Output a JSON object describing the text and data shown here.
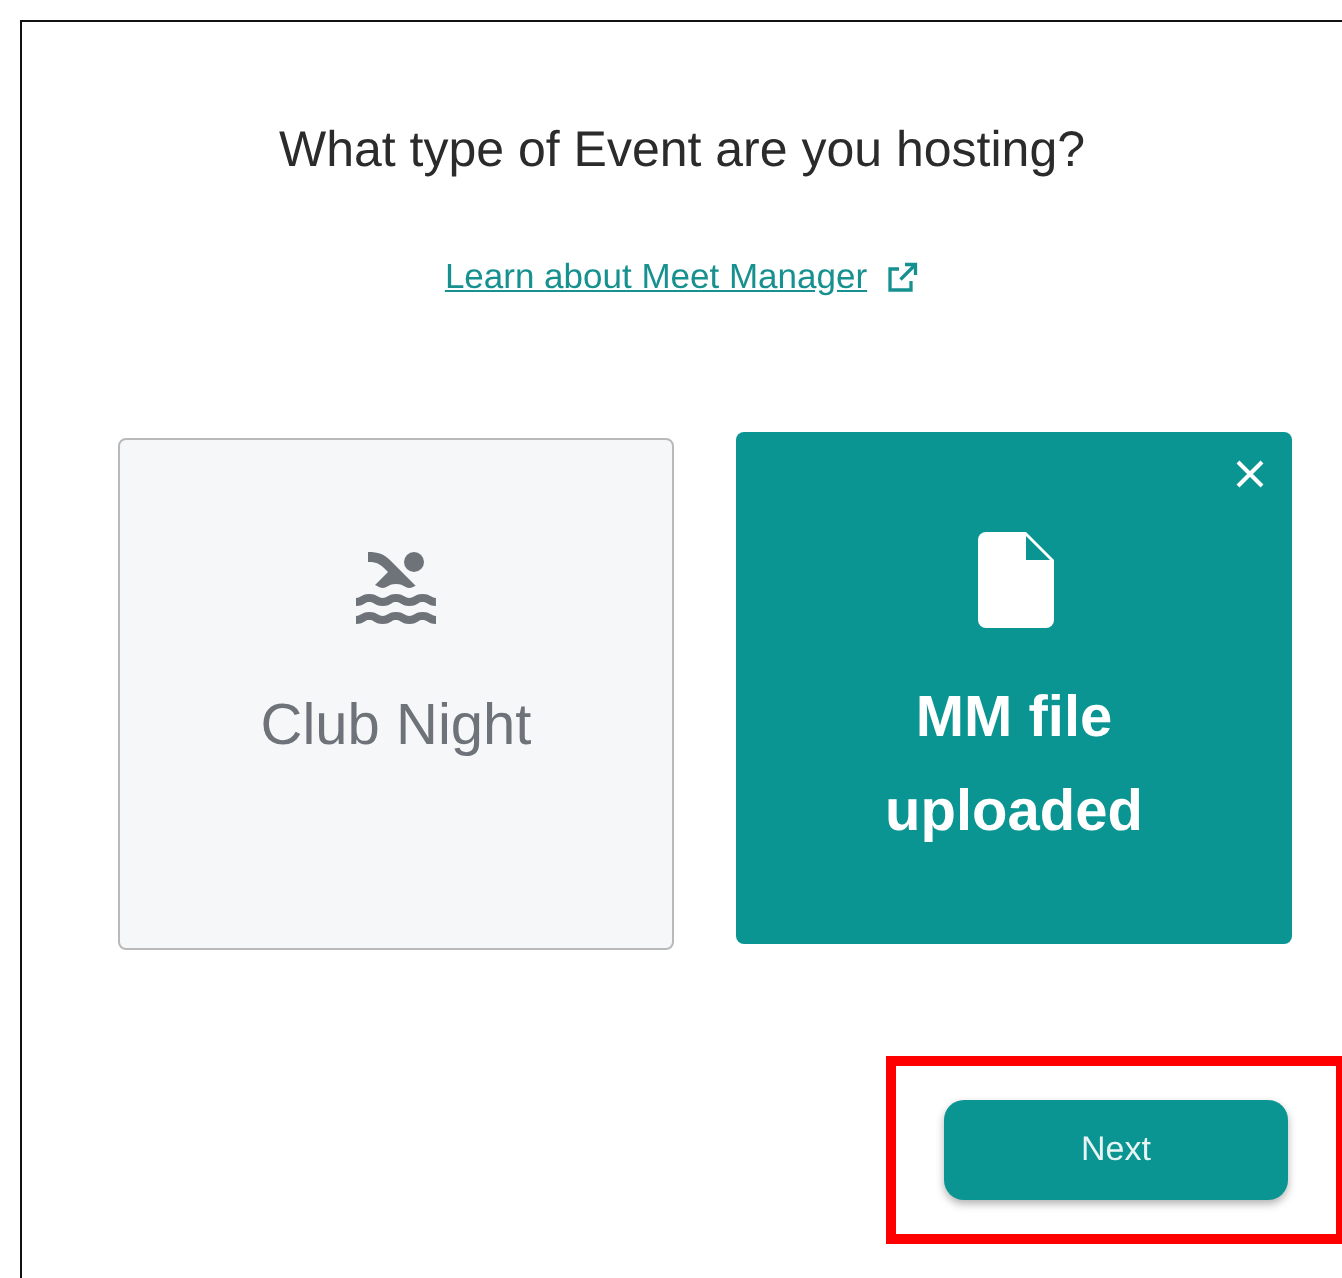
{
  "dialog": {
    "title": "What type of Event are you hosting?",
    "link": {
      "label": "Learn about Meet Manager"
    },
    "options": [
      {
        "kind": "swimmer",
        "label": "Club Night",
        "selected": false
      },
      {
        "kind": "file",
        "label": "MM file uploaded",
        "selected": true
      }
    ],
    "next_button": {
      "label": "Next",
      "highlighted": true
    }
  }
}
